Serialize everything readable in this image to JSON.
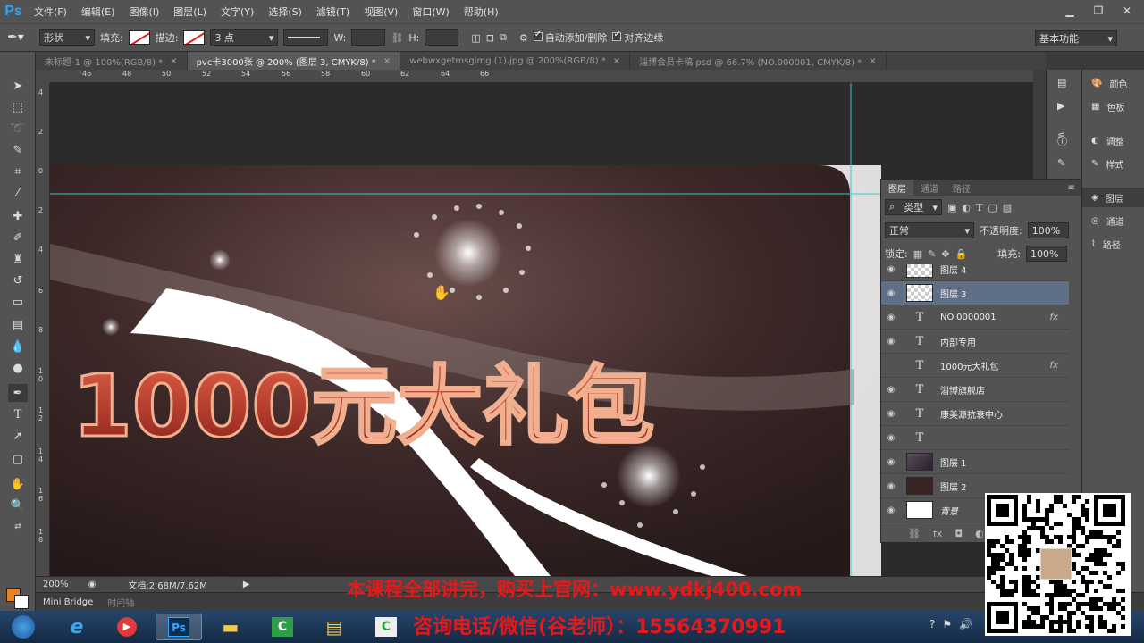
{
  "app": {
    "logo": "Ps"
  },
  "menu": [
    "文件(F)",
    "编辑(E)",
    "图像(I)",
    "图层(L)",
    "文字(Y)",
    "选择(S)",
    "滤镜(T)",
    "视图(V)",
    "窗口(W)",
    "帮助(H)"
  ],
  "options": {
    "mode": "形状",
    "fill_label": "填充:",
    "stroke_label": "描边:",
    "stroke_width": "3 点",
    "w_label": "W:",
    "h_label": "H:",
    "auto_add_delete": "自动添加/删除",
    "align_edges": "对齐边缘",
    "workspace": "基本功能"
  },
  "tabs": [
    {
      "label": "未标题-1 @ 100%(RGB/8) *",
      "active": false
    },
    {
      "label": "pvc卡3000张 @ 200% (图层 3, CMYK/8) *",
      "active": true
    },
    {
      "label": "webwxgetmsgimg (1).jpg @ 200%(RGB/8) *",
      "active": false
    },
    {
      "label": "淄博会员卡稿.psd @ 66.7% (NO.000001, CMYK/8) *",
      "active": false
    }
  ],
  "ruler_h": [
    "46",
    "48",
    "50",
    "52",
    "54",
    "56",
    "58",
    "60",
    "62",
    "64",
    "66"
  ],
  "ruler_v": [
    "4",
    "2",
    "0",
    "2",
    "4",
    "6",
    "8",
    "1 0",
    "1 2",
    "1 4",
    "1 6",
    "1 8"
  ],
  "canvas": {
    "headline": "1000元大礼包"
  },
  "status": {
    "zoom": "200%",
    "doc": "文档:2.68M/7.62M"
  },
  "bottom_tabs": [
    "Mini Bridge",
    "时间轴"
  ],
  "dock": [
    {
      "icon": "palette-icon",
      "label": "颜色"
    },
    {
      "icon": "swatches-icon",
      "label": "色板"
    },
    {
      "icon": "adjustments-icon",
      "label": "调整"
    },
    {
      "icon": "styles-icon",
      "label": "样式"
    },
    {
      "icon": "layers-icon",
      "label": "图层"
    },
    {
      "icon": "channels-icon",
      "label": "通道"
    },
    {
      "icon": "paths-icon",
      "label": "路径"
    }
  ],
  "layers": {
    "tabs": [
      "图层",
      "通道",
      "路径"
    ],
    "filter": "类型",
    "blend": "正常",
    "opacity_label": "不透明度:",
    "opacity": "100%",
    "lock_label": "锁定:",
    "fill_label": "填充:",
    "fill": "100%",
    "rows": [
      {
        "name": "图层 4",
        "kind": "pixel",
        "selected": false,
        "fx": false,
        "visible": true
      },
      {
        "name": "图层 3",
        "kind": "pixel",
        "selected": true,
        "fx": false,
        "visible": true
      },
      {
        "name": "NO.0000001",
        "kind": "text",
        "selected": false,
        "fx": true,
        "visible": true
      },
      {
        "name": "内部专用",
        "kind": "text",
        "selected": false,
        "fx": false,
        "visible": true
      },
      {
        "name": "1000元大礼包",
        "kind": "text",
        "selected": false,
        "fx": true,
        "visible": false
      },
      {
        "name": "淄博旗舰店",
        "kind": "text",
        "selected": false,
        "fx": false,
        "visible": true
      },
      {
        "name": "康美源抗衰中心",
        "kind": "text",
        "selected": false,
        "fx": false,
        "visible": true
      },
      {
        "name": "",
        "kind": "text",
        "selected": false,
        "fx": false,
        "visible": true
      },
      {
        "name": "图层 1",
        "kind": "photo",
        "selected": false,
        "fx": false,
        "visible": true
      },
      {
        "name": "图层 2",
        "kind": "dark",
        "selected": false,
        "fx": false,
        "visible": true
      },
      {
        "name": "背景",
        "kind": "white",
        "selected": false,
        "fx": false,
        "visible": true
      }
    ]
  },
  "watermark": {
    "line1": "本课程全部讲完，购买上官网：www.ydkj400.com",
    "line2": "咨询电话/微信(谷老师）：15564370991"
  },
  "taskbar": [
    "ie-icon",
    "media-icon",
    "Ps",
    "folder-icon",
    "C",
    "notepad-icon",
    "C"
  ]
}
